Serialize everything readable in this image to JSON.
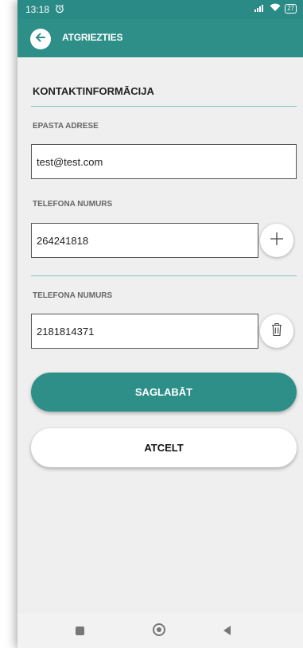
{
  "status_bar": {
    "time": "13:18",
    "alarm_icon": "alarm-icon",
    "signal_icon": "signal-icon",
    "wifi_icon": "wifi-icon",
    "battery": "27"
  },
  "app_bar": {
    "back_icon": "arrow-left-icon",
    "title": "ATGRIEZTIES"
  },
  "section": {
    "title": "KONTAKTINFORMĀCIJA"
  },
  "email": {
    "label": "EPASTA ADRESE",
    "value": "test@test.com"
  },
  "phones": [
    {
      "label": "TELEFONA NUMURS",
      "value": "264241818",
      "action_icon": "plus-icon"
    },
    {
      "label": "TELEFONA NUMURS",
      "value": "2181814371",
      "action_icon": "trash-icon"
    }
  ],
  "buttons": {
    "save": "SAGLABĀT",
    "cancel": "ATCELT"
  },
  "nav_bar": {
    "recents_icon": "square-icon",
    "home_icon": "home-circle-icon",
    "back_icon": "triangle-back-icon"
  },
  "colors": {
    "primary": "#2e8f89",
    "status_bar": "#2a8a85",
    "background": "#efefef",
    "divider": "#7fc3bf"
  }
}
